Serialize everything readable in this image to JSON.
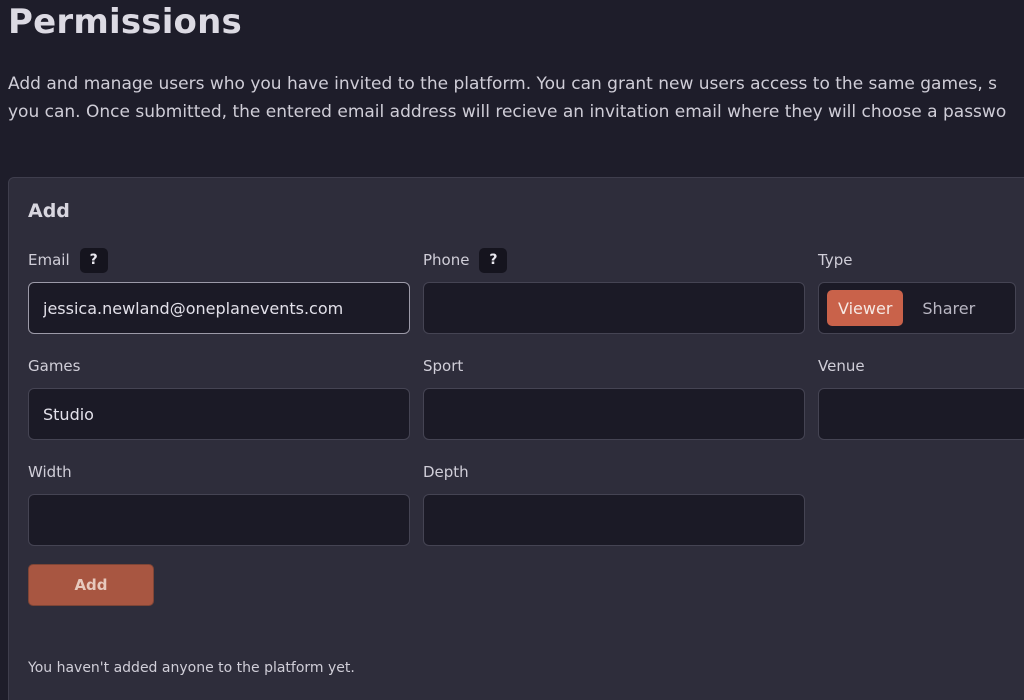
{
  "page": {
    "title": "Permissions",
    "intro_line1": "Add and manage users who you have invited to the platform. You can grant new users access to the same games, s",
    "intro_line2": "you can. Once submitted, the entered email address will recieve an invitation email where they will choose a passwo"
  },
  "add_form": {
    "title": "Add",
    "email": {
      "label": "Email",
      "help": "?",
      "value": "jessica.newland@oneplanevents.com"
    },
    "phone": {
      "label": "Phone",
      "help": "?",
      "value": ""
    },
    "type": {
      "label": "Type",
      "options": [
        "Viewer",
        "Sharer"
      ],
      "selected": "Viewer"
    },
    "games": {
      "label": "Games",
      "value": "Studio"
    },
    "sport": {
      "label": "Sport",
      "value": ""
    },
    "venue": {
      "label": "Venue",
      "value": ""
    },
    "width": {
      "label": "Width",
      "value": ""
    },
    "depth": {
      "label": "Depth",
      "value": ""
    },
    "submit_label": "Add"
  },
  "empty_state": "You haven't added anyone to the platform yet.",
  "colors": {
    "background": "#1e1d2a",
    "card": "#2e2d3b",
    "accent": "#c9624a",
    "input_bg": "#1b1a26"
  }
}
